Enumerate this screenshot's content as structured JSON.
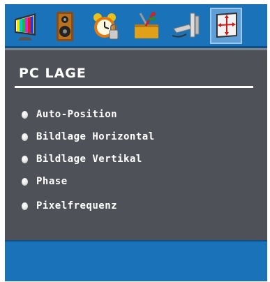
{
  "tabs": [
    {
      "icon": "picture-settings-icon",
      "selected": false
    },
    {
      "icon": "sound-speaker-icon",
      "selected": false
    },
    {
      "icon": "alarm-clock-icon",
      "selected": false
    },
    {
      "icon": "toolbox-settings-icon",
      "selected": false
    },
    {
      "icon": "source-connector-icon",
      "selected": false
    },
    {
      "icon": "pc-position-icon",
      "selected": true
    }
  ],
  "menu": {
    "title": "PC LAGE",
    "items": [
      {
        "label": "Auto-Position"
      },
      {
        "label": "Bildlage Horizontal"
      },
      {
        "label": "Bildlage Vertikal"
      },
      {
        "label": "Phase"
      },
      {
        "label": "Pixelfrequenz"
      }
    ]
  },
  "colors": {
    "osd_blue": "#1a73b8",
    "panel_grey": "#4e5258",
    "text": "#ffffff",
    "selected_tab": "#5d9fd6"
  }
}
